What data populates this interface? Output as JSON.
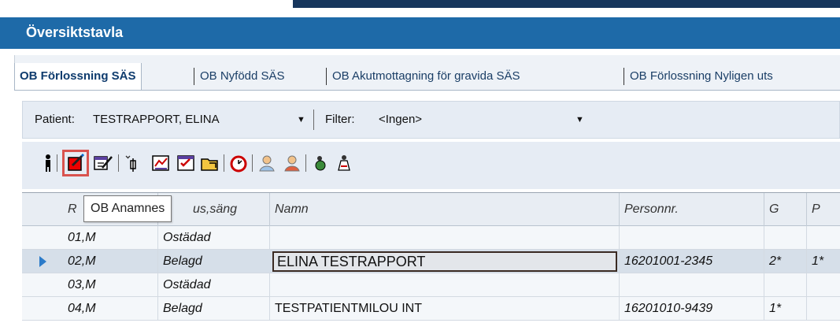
{
  "window": {
    "title": "Översiktstavla"
  },
  "tabs": [
    {
      "label": "OB Förlossning SÄS",
      "active": true
    },
    {
      "label": "OB Nyfödd SÄS",
      "active": false
    },
    {
      "label": "OB Akutmottagning för gravida SÄS",
      "active": false
    },
    {
      "label": "OB Förlossning Nyligen uts",
      "active": false
    }
  ],
  "patientbar": {
    "patient_label": "Patient:",
    "patient_value": "TESTRAPPORT, ELINA",
    "filter_label": "Filter:",
    "filter_value": "<Ingen>"
  },
  "toolbar": {
    "icons": [
      "person-icon",
      "ob-anamnes-icon",
      "form-edit-icon",
      "syringe-icon",
      "chart-icon",
      "checklist-icon",
      "folder-icon",
      "timer-icon",
      "user-add-icon",
      "user-remove-icon",
      "mother-icon",
      "baby-icon"
    ],
    "tooltip": "OB Anamnes"
  },
  "grid": {
    "columns": [
      "R",
      "us,säng",
      "Namn",
      "Personnr.",
      "G",
      "P"
    ],
    "rows": [
      {
        "room": "01,M",
        "status": "Ostädad",
        "name": "",
        "pnr": "",
        "g": "",
        "p": ""
      },
      {
        "room": "02,M",
        "status": "Belagd",
        "name": "ELINA TESTRAPPORT",
        "pnr": "16201001-2345",
        "g": "2*",
        "p": "1*"
      },
      {
        "room": "03,M",
        "status": "Ostädad",
        "name": "",
        "pnr": "",
        "g": "",
        "p": ""
      },
      {
        "room": "04,M",
        "status": "Belagd",
        "name": "TESTPATIENTMILOU INT",
        "pnr": "16201010-9439",
        "g": "1*",
        "p": ""
      }
    ]
  },
  "colors": {
    "title_bg": "#1e6aa8",
    "highlight": "#d9534f",
    "selected_row": "#d6dfe9"
  }
}
